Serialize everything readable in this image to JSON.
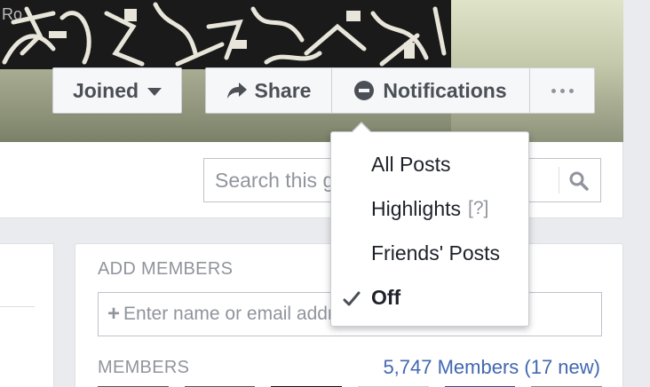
{
  "cover": {
    "watermark": "Ro"
  },
  "actions": {
    "joined_label": "Joined",
    "share_label": "Share",
    "notifications_label": "Notifications"
  },
  "search": {
    "placeholder": "Search this group"
  },
  "notifications_menu": {
    "items": [
      {
        "label": "All Posts",
        "hint": "",
        "selected": false
      },
      {
        "label": "Highlights",
        "hint": "[?]",
        "selected": false
      },
      {
        "label": "Friends' Posts",
        "hint": "",
        "selected": false
      },
      {
        "label": "Off",
        "hint": "",
        "selected": true
      }
    ]
  },
  "add_members": {
    "title": "ADD MEMBERS",
    "placeholder": "Enter name or email address..."
  },
  "members": {
    "title": "MEMBERS",
    "count_text": "5,747 Members (17 new)"
  },
  "colors": {
    "link": "#4267b2",
    "button_text": "#4b4f56",
    "muted": "#90949c"
  }
}
